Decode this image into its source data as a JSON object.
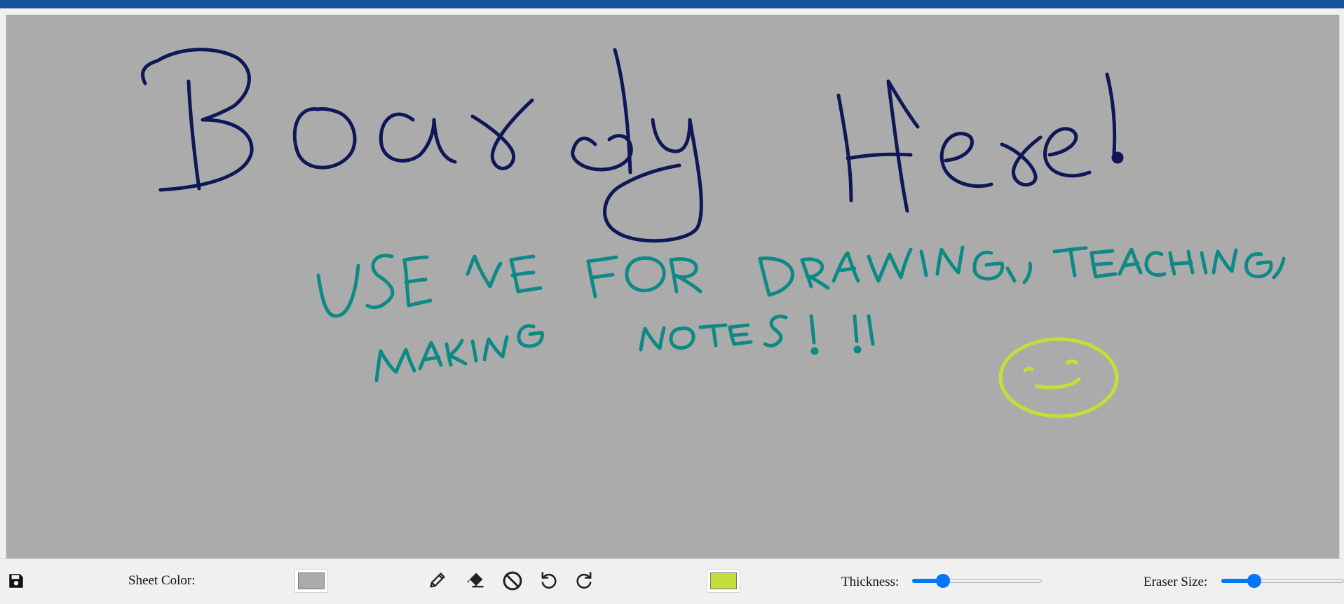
{
  "canvas": {
    "background_color": "#acabab",
    "handwriting": {
      "title": "Boardy Here!",
      "line1": "USE ME FOR DRAWING, TEACHING,",
      "line2": "MAKING NOTES!!!"
    },
    "colors": {
      "title_ink": "#0e1757",
      "subtitle_ink": "#0d8a85",
      "smiley_ink": "#c8dd35"
    }
  },
  "toolbar": {
    "save_icon": "floppy-disk-icon",
    "sheet_color_label": "Sheet Color:",
    "sheet_color_value": "#acabab",
    "tools": {
      "pencil_icon": "pencil-icon",
      "eraser_icon": "eraser-icon",
      "clear_icon": "ban-icon",
      "undo_icon": "undo-icon",
      "redo_icon": "redo-icon"
    },
    "pen_color_value": "#c3dd3b",
    "thickness_label": "Thickness:",
    "thickness_value": 0.24,
    "eraser_size_label": "Eraser Size:",
    "eraser_size_value": 0.27
  }
}
